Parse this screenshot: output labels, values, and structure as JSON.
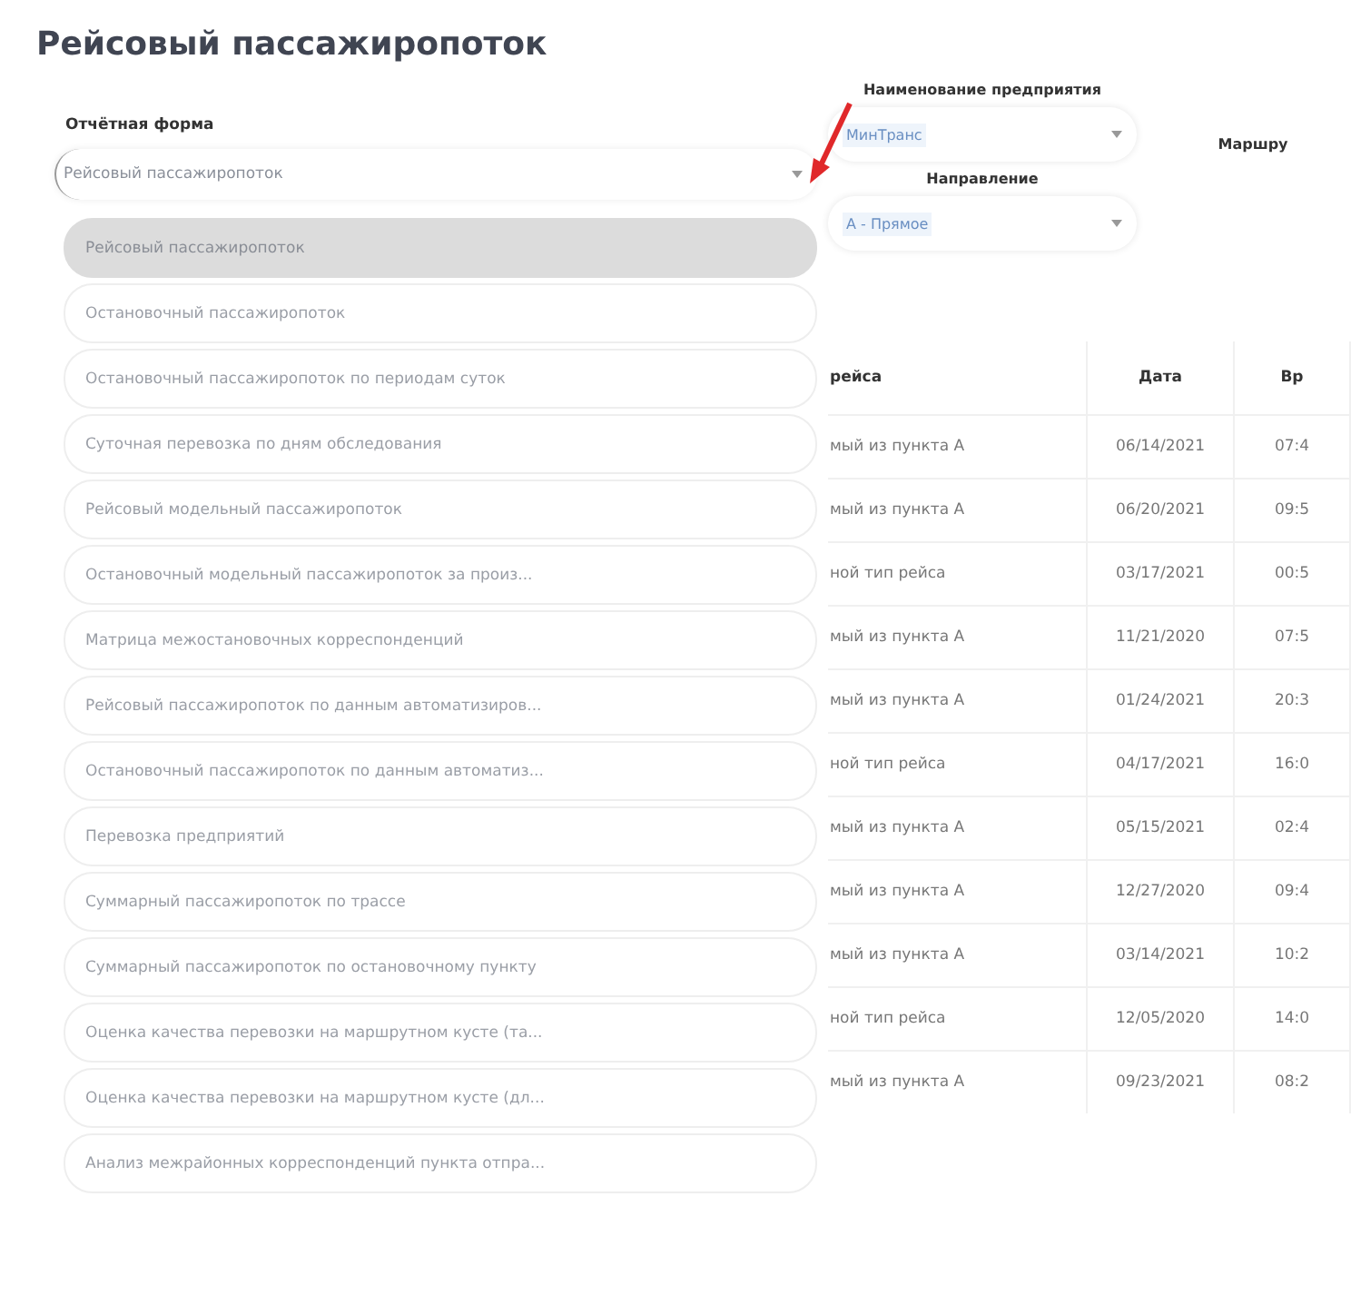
{
  "page_title": "Рейсовый пассажиропоток",
  "report_form": {
    "label": "Отчётная форма",
    "value": "Рейсовый пассажиропоток",
    "expanded": true,
    "options": [
      {
        "label": "Рейсовый пассажиропоток",
        "selected": true
      },
      {
        "label": "Остановочный пассажиропоток",
        "selected": false
      },
      {
        "label": "Остановочный пассажиропоток по периодам суток",
        "selected": false
      },
      {
        "label": "Суточная перевозка по дням обследования",
        "selected": false
      },
      {
        "label": "Рейсовый модельный пассажиропоток",
        "selected": false
      },
      {
        "label": "Остановочный модельный пассажиропоток за произ...",
        "selected": false
      },
      {
        "label": "Матрица межостановочных корреспонденций",
        "selected": false
      },
      {
        "label": "Рейсовый пассажиропоток по данным автоматизиров...",
        "selected": false
      },
      {
        "label": "Остановочный пассажиропоток по данным автоматиз...",
        "selected": false
      },
      {
        "label": "Перевозка предприятий",
        "selected": false
      },
      {
        "label": "Суммарный пассажиропоток по трассе",
        "selected": false
      },
      {
        "label": "Суммарный пассажиропоток по остановочному пункту",
        "selected": false
      },
      {
        "label": "Оценка качества перевозки на маршрутном кусте (та...",
        "selected": false
      },
      {
        "label": "Оценка качества перевозки на маршрутном кусте (дл...",
        "selected": false
      },
      {
        "label": "Анализ межрайонных корреспонденций пункта отпра...",
        "selected": false
      }
    ]
  },
  "filters": {
    "enterprise": {
      "label": "Наименование предприятия",
      "value": "МинТранс"
    },
    "route": {
      "label": "Маршру"
    },
    "direction": {
      "label": "Направление",
      "value": "А - Прямое"
    }
  },
  "table": {
    "columns": [
      "рейса",
      "Дата",
      "Вр"
    ],
    "rows": [
      [
        "мый из пункта А",
        "06/14/2021",
        "07:4"
      ],
      [
        "мый из пункта А",
        "06/20/2021",
        "09:5"
      ],
      [
        "ной тип рейса",
        "03/17/2021",
        "00:5"
      ],
      [
        "мый из пункта А",
        "11/21/2020",
        "07:5"
      ],
      [
        "мый из пункта А",
        "01/24/2021",
        "20:3"
      ],
      [
        "ной тип рейса",
        "04/17/2021",
        "16:0"
      ],
      [
        "мый из пункта А",
        "05/15/2021",
        "02:4"
      ],
      [
        "мый из пункта А",
        "12/27/2020",
        "09:4"
      ],
      [
        "мый из пункта А",
        "03/14/2021",
        "10:2"
      ],
      [
        "ной тип рейса",
        "12/05/2020",
        "14:0"
      ],
      [
        "мый из пункта А",
        "09/23/2021",
        "08:2"
      ]
    ]
  }
}
